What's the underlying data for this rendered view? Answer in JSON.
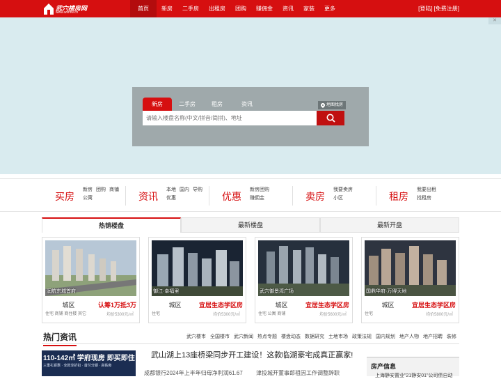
{
  "header": {
    "logo_text": "武穴楼房网",
    "logo_url": "www.wxhfw.cn",
    "nav": [
      "首页",
      "新房",
      "二手房",
      "出租房",
      "团购",
      "赚佣金",
      "资讯",
      "家装",
      "更多"
    ],
    "login_label": "[登陆]",
    "register_label": "[免费注册]"
  },
  "search": {
    "tabs": [
      "新房",
      "二手房",
      "租房",
      "资讯"
    ],
    "map_label": "地图找房",
    "placeholder": "请输入楼盘名称(中文/拼音/简拼)、地址"
  },
  "categories": [
    {
      "title": "买房",
      "links": [
        "新房",
        "团购",
        "商铺",
        "公寓"
      ]
    },
    {
      "title": "资讯",
      "links": [
        "本地",
        "国内",
        "导购",
        "优惠"
      ]
    },
    {
      "title": "优惠",
      "links": [
        "新房团购",
        "赚佣金"
      ]
    },
    {
      "title": "卖房",
      "links": [
        "我要卖房",
        "小区"
      ]
    },
    {
      "title": "租房",
      "links": [
        "我要出租",
        "找租房"
      ]
    }
  ],
  "listing_tabs": [
    "热销楼盘",
    "最新楼盘",
    "最新开盘"
  ],
  "listings": [
    {
      "caption": "润航东城首府",
      "district": "城区",
      "types": "住宅 商铺 商住楼 其它",
      "promo": "认筹1万抵3万",
      "price": "均价5300元/㎡"
    },
    {
      "caption": "御江·幸福里",
      "district": "城区",
      "types": "住宅",
      "promo": "宜居生态学区房",
      "price": "均价5300元/㎡"
    },
    {
      "caption": "武穴御景湾广场",
      "district": "城区",
      "types": "住宅 公寓 商铺",
      "promo": "宜居生态学区房",
      "price": "均价5600元/㎡"
    },
    {
      "caption": "国鼎华府·万得天地",
      "district": "城区",
      "types": "住宅",
      "promo": "宜居生态学区房",
      "price": "均价5800元/㎡"
    }
  ],
  "news": {
    "title": "热门资讯",
    "links": [
      "武穴楼市",
      "全国楼市",
      "武穴新闻",
      "热点专题",
      "楼盘动态",
      "数据研究",
      "土地市场",
      "政策法规",
      "国内规划",
      "地产人物",
      "地产招聘",
      "装修"
    ],
    "ad_line1": "110-142㎡ 学府现房 即买即住",
    "ad_line2": "三重礼钜惠 · 全款享折扣 · 首付分期 · 高铁旁",
    "headline": "武山湖上13座桥梁同步开工建设！这款临湖豪宅成真正赢家!",
    "sub_news": [
      "成都银行2024年上半年归母净利润61.67",
      "津投城开董事郎祖因工作调整辞职"
    ],
    "side_title": "房产信息",
    "side_item": "上海静安置业\"21静安01\"公司债自动"
  }
}
